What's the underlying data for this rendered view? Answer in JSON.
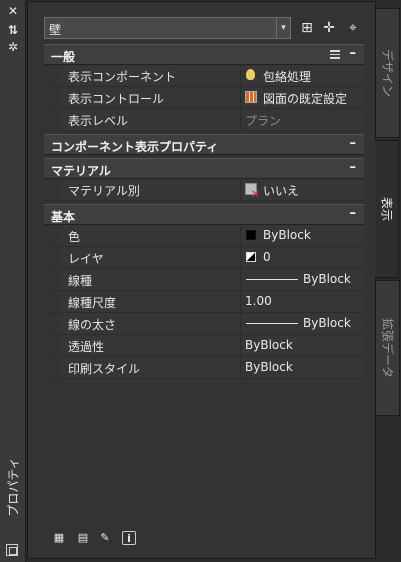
{
  "strip": {
    "title": "プロパティ",
    "controls": [
      "close-icon",
      "autohide-icon",
      "settings-icon"
    ]
  },
  "toolbar": {
    "object_type": "壁",
    "buttons": [
      "quick-select-icon",
      "select-objects-icon",
      "toggle-pickadd-icon"
    ]
  },
  "categories": [
    {
      "label": "一般",
      "rows": [
        {
          "label": "表示コンポーネント",
          "value": "包絡処理",
          "icon": "bulb-icon"
        },
        {
          "label": "表示コントロール",
          "value": "図面の既定設定",
          "icon": "grid-icon"
        },
        {
          "label": "表示レベル",
          "value": "プラン",
          "dim": true
        }
      ]
    },
    {
      "label": "コンポーネント表示プロパティ",
      "rows": []
    },
    {
      "label": "マテリアル",
      "rows": [
        {
          "label": "マテリアル別",
          "value": "いいえ",
          "icon": "material-icon"
        }
      ]
    },
    {
      "label": "基本",
      "rows": [
        {
          "label": "色",
          "value": "ByBlock",
          "icon": "color-swatch-icon"
        },
        {
          "label": "レイヤ",
          "value": "0",
          "icon": "layer-icon"
        },
        {
          "label": "線種",
          "value": "ByBlock",
          "icon": "linetype-icon"
        },
        {
          "label": "線種尺度",
          "value": "1.00"
        },
        {
          "label": "線の太さ",
          "value": "ByBlock",
          "icon": "lineweight-icon"
        },
        {
          "label": "透過性",
          "value": "ByBlock"
        },
        {
          "label": "印刷スタイル",
          "value": "ByBlock"
        }
      ]
    }
  ],
  "tabs": [
    {
      "label": "デザイン",
      "active": false
    },
    {
      "label": "表示",
      "active": true
    },
    {
      "label": "拡張データ",
      "active": false
    }
  ],
  "bottom_icons": [
    "select-components-icon",
    "edit-style-icon",
    "paint-icon",
    "info-icon"
  ],
  "colors": {
    "panel": "#333333",
    "category": "#3f3f3f",
    "text": "#e6e6e6",
    "dim_text": "#8d8d8d"
  }
}
